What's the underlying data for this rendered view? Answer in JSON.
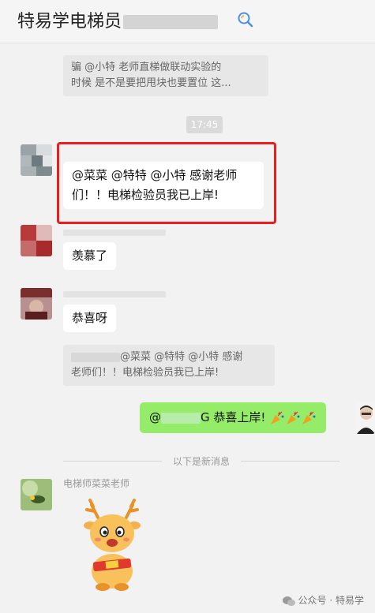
{
  "header": {
    "title": "特易学电梯员"
  },
  "messages": {
    "quote1_line1": "骗  @小特  老师直梯做联动实验的",
    "quote1_line2": "时候  是不是要把甩块也要置位  这...",
    "time": "17:45",
    "msg1_line1": "@菜菜 @特特 @小特 感谢老师",
    "msg1_line2": "们！！电梯检验员我已上岸!",
    "msg2": "羡慕了",
    "msg3": "恭喜呀",
    "quote2_line1": "@菜菜 @特特 @小特 感谢",
    "quote2_line2": "老师们！！电梯检验员我已上岸!",
    "my_msg_prefix": "@",
    "my_msg_mid": "G",
    "my_msg_text": "恭喜上岸!",
    "divider": "以下是新消息",
    "sender_name": "电梯师菜菜老师"
  },
  "footer": {
    "watermark": "公众号 · 特易学"
  },
  "colors": {
    "my_bubble": "#95ec69",
    "highlight_box": "#ee1c1c"
  }
}
